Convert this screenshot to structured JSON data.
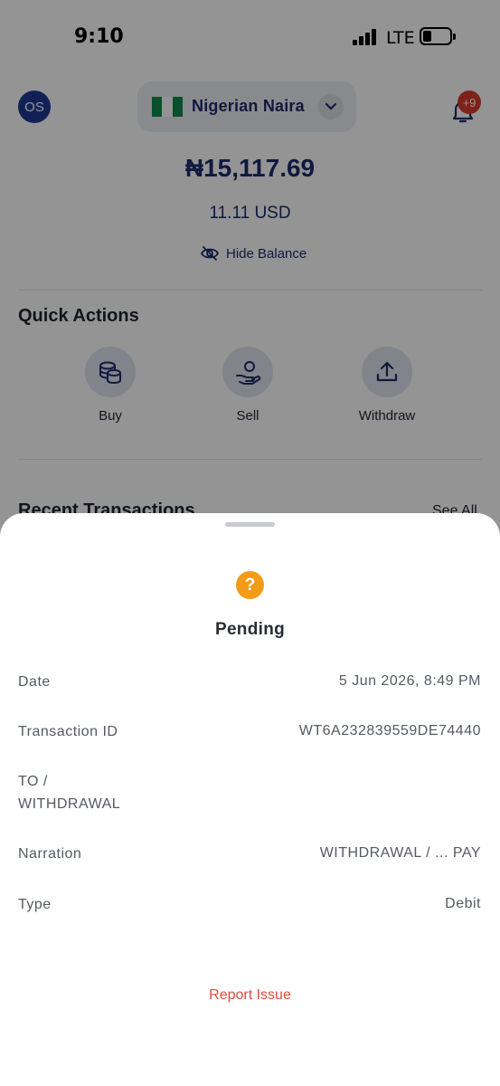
{
  "status_bar": {
    "time": "9:10",
    "network": "LTE",
    "battery_level": 0.2
  },
  "header": {
    "avatar_initials": "OS",
    "currency": {
      "label": "Nigerian Naira",
      "flag_colors": [
        "#118a4c",
        "#ffffff",
        "#118a4c"
      ]
    },
    "notifications_badge": "+9"
  },
  "balance": {
    "amount": "₦15,117.69",
    "usd_equivalent": "11.11 USD",
    "hide_label": "Hide Balance"
  },
  "quick_actions": {
    "title": "Quick Actions",
    "items": [
      {
        "label": "Buy",
        "icon": "coins-icon"
      },
      {
        "label": "Sell",
        "icon": "hand-coin-icon"
      },
      {
        "label": "Withdraw",
        "icon": "upload-icon"
      }
    ]
  },
  "recent_transactions": {
    "title": "Recent Transactions",
    "see_all": "See All"
  },
  "sheet": {
    "status": "Pending",
    "status_color": "#f39a17",
    "rows": [
      {
        "label": "Date",
        "value": "5 Jun 2026, 8:49 PM"
      },
      {
        "label": "Transaction ID",
        "value": "WT6A232839559DE74440"
      },
      {
        "label": "TO /\nWITHDRAWAL",
        "value": ""
      },
      {
        "label": "Narration",
        "value": "WITHDRAWAL / ... PAY"
      },
      {
        "label": "Type",
        "value": "Debit"
      }
    ],
    "report_label": "Report Issue",
    "report_color": "#e04a3a"
  },
  "colors": {
    "brand_navy": "#1d2b6b",
    "avatar_bg": "#1f3a93",
    "badge_red": "#d83b2e"
  }
}
